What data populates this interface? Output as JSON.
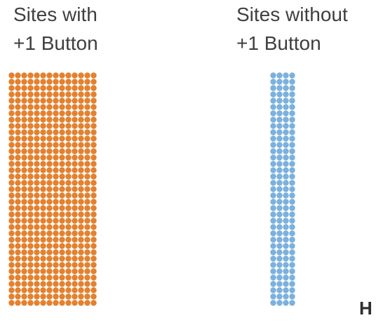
{
  "chart_data": {
    "type": "dot-matrix",
    "series": [
      {
        "name_lines": [
          "Sites with",
          "+1 Button"
        ],
        "color": "#E3812F",
        "columns": 14,
        "rows": 37
      },
      {
        "name_lines": [
          "Sites without",
          "+1 Button"
        ],
        "color": "#7BB1DD",
        "columns": 4,
        "rows": 37
      }
    ]
  },
  "corner_text": "H"
}
